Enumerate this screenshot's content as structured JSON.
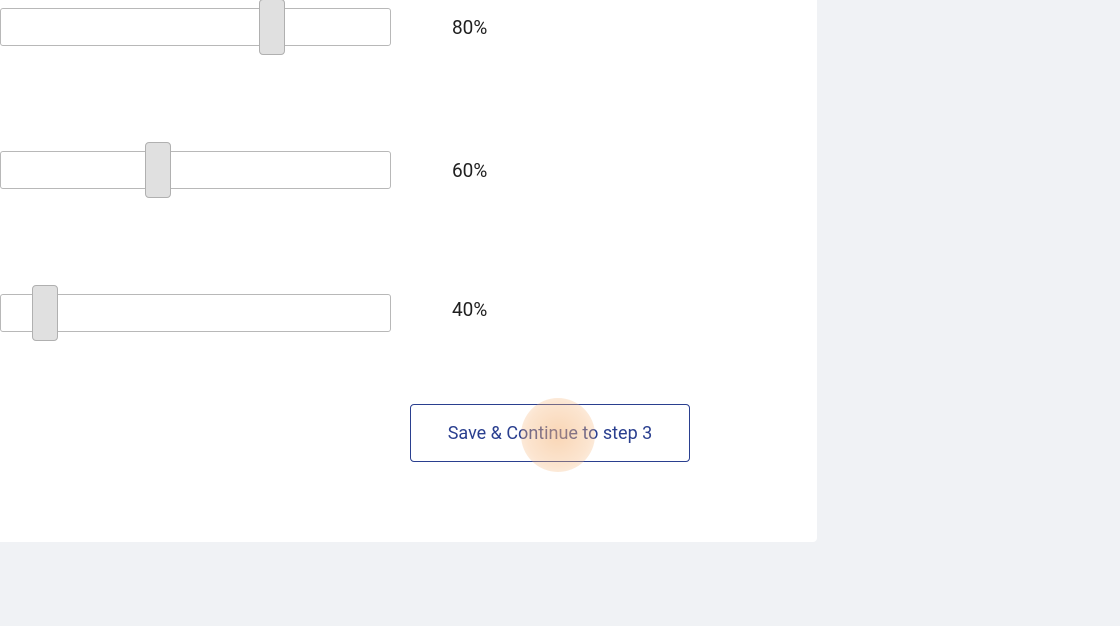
{
  "sliders": [
    {
      "value_label": "80%"
    },
    {
      "value_label": "60%"
    },
    {
      "value_label": "40%"
    }
  ],
  "actions": {
    "continue_label": "Save & Continue to step 3"
  }
}
